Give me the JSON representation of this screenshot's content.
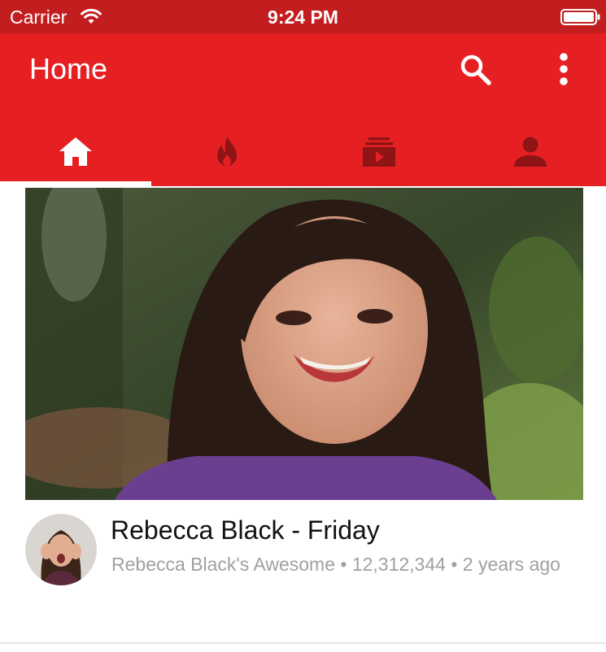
{
  "status_bar": {
    "carrier": "Carrier",
    "time": "9:24 PM",
    "icons": [
      "wifi-icon",
      "battery-icon"
    ]
  },
  "header": {
    "title": "Home",
    "actions": [
      "search-icon",
      "more-vertical-icon"
    ]
  },
  "tabs": [
    {
      "icon": "home-icon",
      "active": true
    },
    {
      "icon": "trending-fire-icon",
      "active": false
    },
    {
      "icon": "subscriptions-icon",
      "active": false
    },
    {
      "icon": "account-icon",
      "active": false
    }
  ],
  "video": {
    "title": "Rebecca Black - Friday",
    "channel": "Rebecca Black's Awesome",
    "views": "12,312,344",
    "age": "2 years ago",
    "meta_line": "Rebecca Black's Awesome • 12,312,344 • 2 years ago"
  },
  "colors": {
    "status_bar": "#c31e1f",
    "header": "#e62022",
    "inactive_tab_icon": "#8e1416",
    "active_tab_icon": "#ffffff",
    "meta_text": "#a0a0a0"
  }
}
